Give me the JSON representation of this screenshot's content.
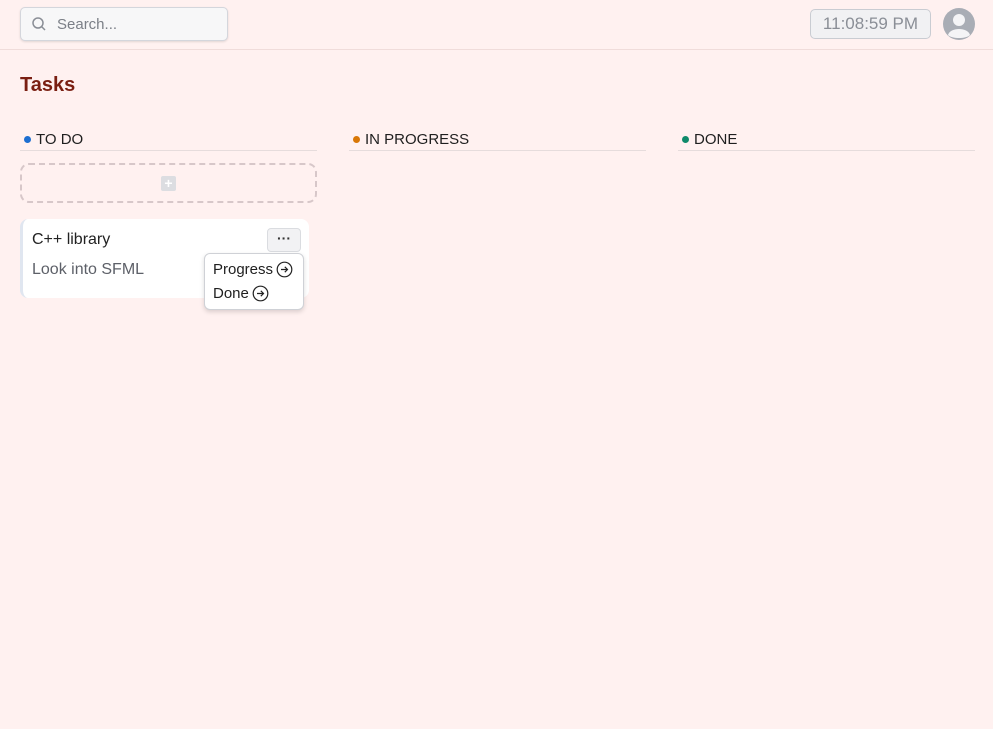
{
  "header": {
    "search_placeholder": "Search...",
    "clock": "11:08:59 PM"
  },
  "page": {
    "title": "Tasks"
  },
  "columns": [
    {
      "label": "TO DO",
      "color": "#1d6fd1"
    },
    {
      "label": "IN PROGRESS",
      "color": "#d97706"
    },
    {
      "label": "DONE",
      "color": "#0f8a6a"
    }
  ],
  "card": {
    "title": "C++ library",
    "description": "Look into SFML"
  },
  "menu": {
    "items": [
      {
        "label": "Progress"
      },
      {
        "label": "Done"
      }
    ]
  }
}
